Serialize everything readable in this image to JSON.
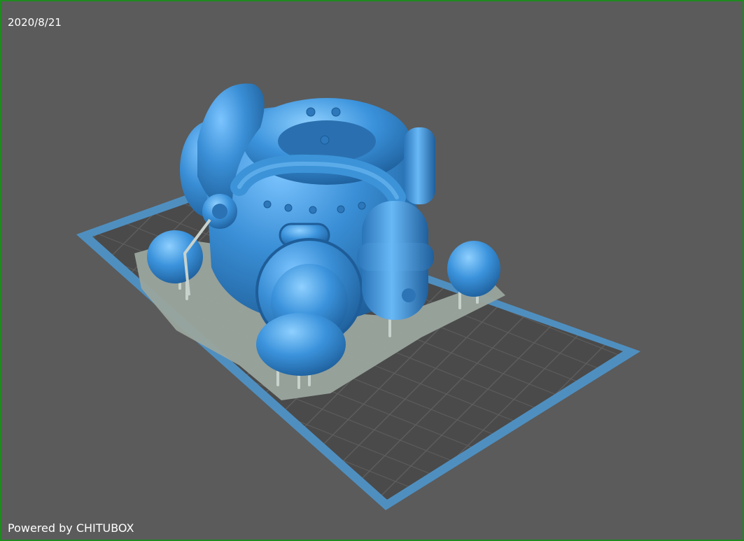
{
  "viewport": {
    "date": "2020/8/21",
    "powered_by": "Powered by CHITUBOX"
  },
  "colors": {
    "background": "#5b5b5b",
    "border": "#1f8a1f",
    "plate_frame": "#4f8fc0",
    "plate_fill": "#4a4a4a",
    "model": "#3a8fd6",
    "support_raft": "#9aa59e"
  },
  "scene": {
    "object": "robot-diving-suit-model",
    "build_plate": "build-plate-grid"
  }
}
